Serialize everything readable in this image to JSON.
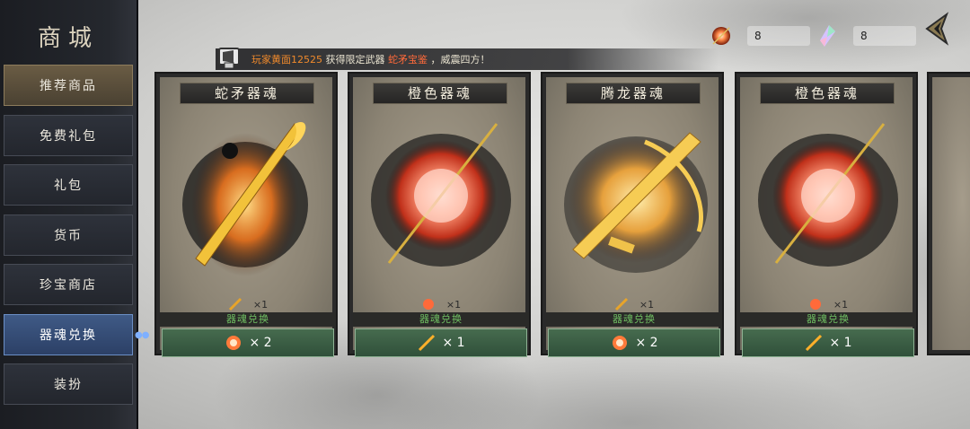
{
  "sidebar": {
    "title": "商城",
    "items": [
      {
        "label": "推荐商品",
        "state": "highlight"
      },
      {
        "label": "免费礼包",
        "state": "normal"
      },
      {
        "label": "礼包",
        "state": "normal"
      },
      {
        "label": "货币",
        "state": "normal"
      },
      {
        "label": "珍宝商店",
        "state": "normal"
      },
      {
        "label": "器魂兑换",
        "state": "active"
      },
      {
        "label": "装扮",
        "state": "normal"
      }
    ]
  },
  "currency": [
    {
      "icon": "orange-orb-icon",
      "value": "8"
    },
    {
      "icon": "crystal-icon",
      "value": "8"
    }
  ],
  "ticker": {
    "player": "玩家黄面12525",
    "verb": "获得限定武器",
    "weapon": "蛇矛宝鉴",
    "suffix": "，威震四方！"
  },
  "cards": [
    {
      "title": "蛇矛器魂",
      "count": "×1",
      "exchange_label": "器魂兑换",
      "price": "× 2",
      "price_icon": "orange-orb-icon",
      "art": "golden-spear-icon"
    },
    {
      "title": "橙色器魂",
      "count": "×1",
      "exchange_label": "器魂兑换",
      "price": "× 1",
      "price_icon": "gold-spear-icon",
      "art": "fire-orb-icon"
    },
    {
      "title": "腾龙器魂",
      "count": "×1",
      "exchange_label": "器魂兑换",
      "price": "× 2",
      "price_icon": "orange-orb-icon",
      "art": "golden-crossbow-icon"
    },
    {
      "title": "橙色器魂",
      "count": "×1",
      "exchange_label": "器魂兑换",
      "price": "× 1",
      "price_icon": "gold-spear-icon",
      "art": "fire-orb-icon"
    }
  ],
  "colors": {
    "active_tab": "#3f5a86",
    "price_button": "#3d5f45",
    "exchange_label_text": "#6fbf62"
  }
}
